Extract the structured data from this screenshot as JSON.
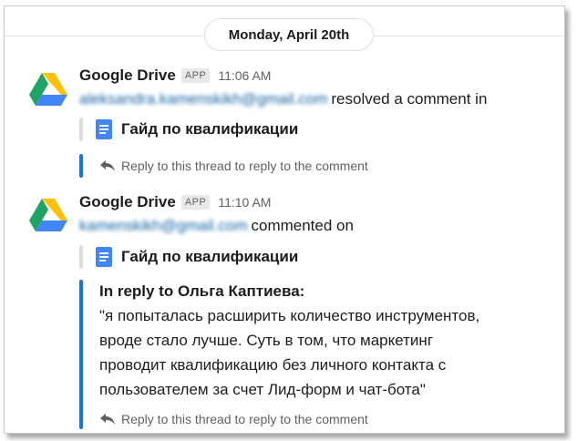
{
  "date_divider": "Monday, April 20th",
  "messages": [
    {
      "sender": "Google Drive",
      "badge": "APP",
      "time": "11:06 AM",
      "email": "aleksandra.kamenskikh@gmail.com",
      "action": "resolved a comment in",
      "document_title": "Гайд по квалификации",
      "reply_hint": "Reply to this thread to reply to the comment"
    },
    {
      "sender": "Google Drive",
      "badge": "APP",
      "time": "11:10 AM",
      "email": "kamenskikh@gmail.com",
      "action": "commented on",
      "document_title": "Гайд по квалификации",
      "quote_heading": "In reply to Ольга Каптиева:",
      "quote_lines": [
        "\"я попыталась расширить количество инструментов,",
        "вроде стало лучше. Суть в том, что маркетинг",
        "проводит квалификацию без личного контакта с",
        "пользователем за счет Лид-форм и чат-бота\""
      ],
      "reply_hint": "Reply to this thread to reply to the comment"
    }
  ],
  "icons": {
    "avatar": "google-drive-logo",
    "document": "google-docs-icon",
    "reply": "reply-arrow-icon"
  },
  "colors": {
    "accent_bar": "#1d74d6",
    "link": "#1264a3",
    "doc_icon": "#4285f4"
  }
}
